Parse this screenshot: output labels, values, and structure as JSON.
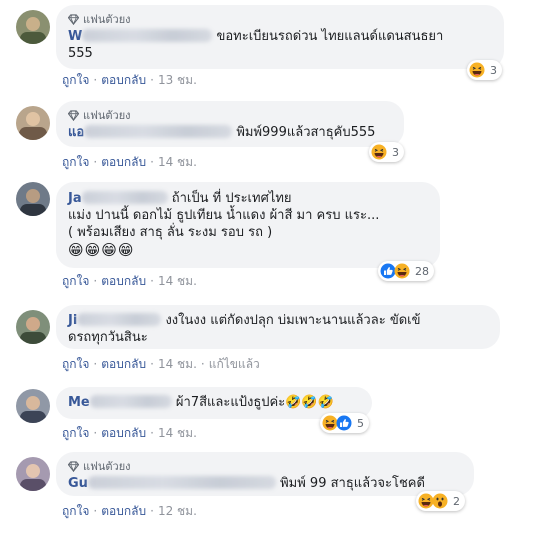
{
  "badge_label": "แฟนตัวยง",
  "actions": {
    "like": "ถูกใจ",
    "reply": "ตอบกลับ",
    "edited": "แก้ไขแล้ว",
    "separator": "·"
  },
  "colors": {
    "bubble": "#f2f3f5",
    "author": "#385898",
    "meta": "#90949c"
  },
  "comments": [
    {
      "author_visible": "W",
      "lines": [
        "ขอทะเบียนรถด่วน ไทยแลนด์แดนสนธยา",
        "555"
      ],
      "reactions": [
        "haha-icon"
      ],
      "reaction_count": "3",
      "time": "13 ชม."
    },
    {
      "author_visible": "แอ",
      "lines": [
        "พิมพ์999แล้วสาธุคับ555"
      ],
      "reactions": [
        "haha-icon"
      ],
      "reaction_count": "3",
      "time": "14 ชม."
    },
    {
      "author_visible": "Ja",
      "lines": [
        "ถ้าเป็น ที่ ประเทศไทย",
        "แม่ง ปานนี้ ดอกไม้ ธูปเทียน น้ำแดง ผ้าสี มา ครบ แระ...",
        "( พร้อมเสียง สาธุ ลั่น ระงม รอบ รถ )"
      ],
      "emoji_line": "😁😁😁😁",
      "reactions": [
        "like-icon",
        "haha-icon"
      ],
      "reaction_count": "28",
      "time": "14 ชม."
    },
    {
      "author_visible": "Ji",
      "lines": [
        "งงในงง แต่กัดงปลุก บ่มเพาะนานแล้วละ ขัดเข้",
        "ดรถทุกวันสินะ"
      ],
      "reactions": [],
      "reaction_count": "",
      "time": "14 ชม."
    },
    {
      "author_visible": "Me",
      "lines": [
        "ผ้า7สีและแป้งธูปค่ะ🤣🤣🤣"
      ],
      "reactions": [
        "haha-icon",
        "like-icon"
      ],
      "reaction_count": "5",
      "time": "14 ชม."
    },
    {
      "author_visible": "Gu",
      "lines": [
        "พิมพ์ 99 สาธุแล้วจะโชคดี"
      ],
      "reactions": [
        "haha-icon",
        "wow-icon"
      ],
      "reaction_count": "2",
      "time": "12 ชม."
    }
  ]
}
